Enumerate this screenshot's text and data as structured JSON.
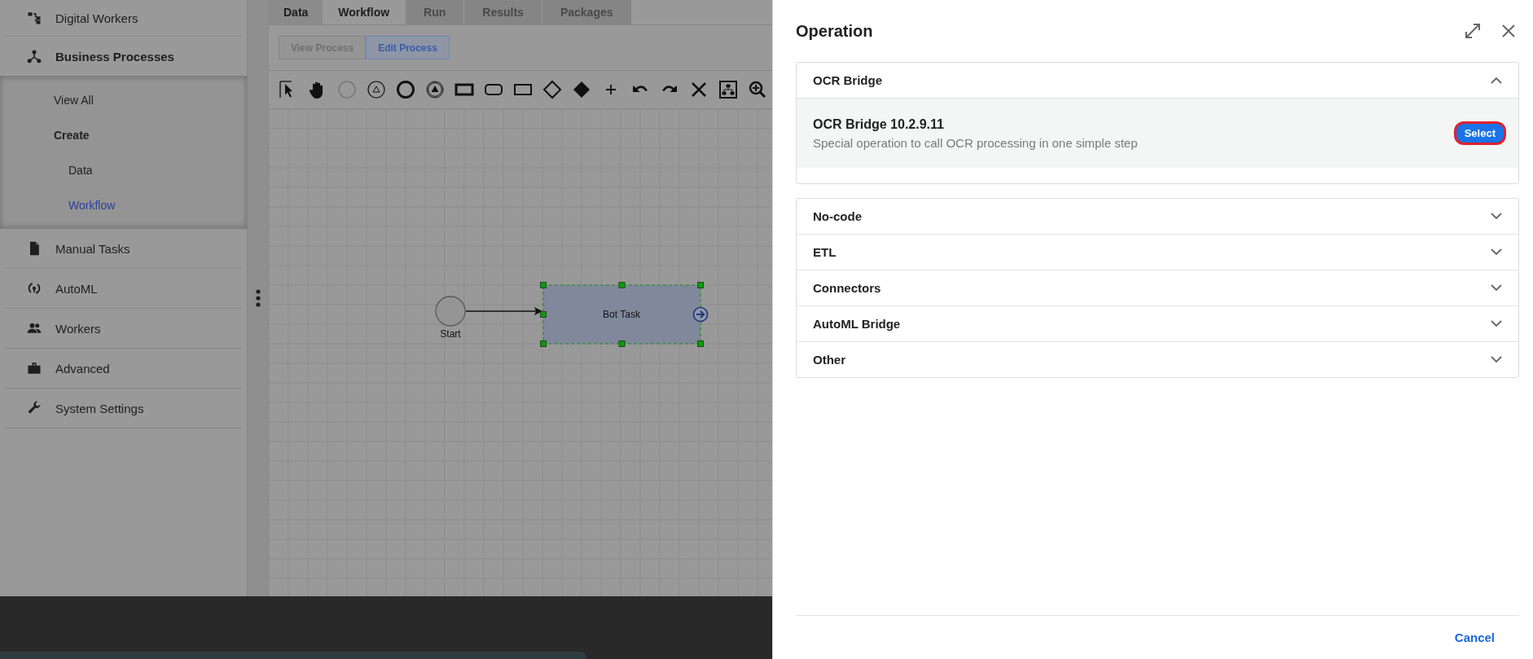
{
  "sidebar": {
    "items": [
      {
        "label": "Digital Workers",
        "expanded": false
      },
      {
        "label": "Business Processes",
        "expanded": true,
        "children": [
          {
            "label": "View All",
            "selected": false
          },
          {
            "label": "Create",
            "selected": false,
            "expanded": true,
            "children": [
              {
                "label": "Data",
                "selected": false
              },
              {
                "label": "Workflow",
                "selected": true
              }
            ]
          }
        ]
      },
      {
        "label": "Manual Tasks",
        "expanded": false
      },
      {
        "label": "AutoML",
        "expanded": false
      },
      {
        "label": "Workers",
        "expanded": false
      },
      {
        "label": "Advanced",
        "expanded": false
      },
      {
        "label": "System Settings",
        "expanded": false
      }
    ]
  },
  "tabs": [
    {
      "label": "Data",
      "selected": false,
      "disabled": false
    },
    {
      "label": "Workflow",
      "selected": true,
      "disabled": false
    },
    {
      "label": "Run",
      "selected": false,
      "disabled": true
    },
    {
      "label": "Results",
      "selected": false,
      "disabled": true
    },
    {
      "label": "Packages",
      "selected": false,
      "disabled": true
    }
  ],
  "modes": [
    {
      "label": "View Process",
      "selected": false
    },
    {
      "label": "Edit Process",
      "selected": true
    }
  ],
  "diagram": {
    "nodes": [
      {
        "kind": "start",
        "label": "Start",
        "selected": false
      },
      {
        "kind": "task",
        "label": "Bot Task",
        "selected": true
      }
    ]
  },
  "panel": {
    "title": "Operation",
    "groups": [
      {
        "title": "OCR Bridge",
        "expanded": true,
        "operations": [
          {
            "name": "OCR Bridge 10.2.9.11",
            "description": "Special operation to call OCR processing in one simple step",
            "action": {
              "label": "Select",
              "focused": true
            }
          }
        ]
      },
      {
        "title": "No-code",
        "expanded": false
      },
      {
        "title": "ETL",
        "expanded": false
      },
      {
        "title": "Connectors",
        "expanded": false
      },
      {
        "title": "AutoML Bridge",
        "expanded": false
      },
      {
        "title": "Other",
        "expanded": false
      }
    ],
    "footer": {
      "cancel": "Cancel"
    }
  }
}
